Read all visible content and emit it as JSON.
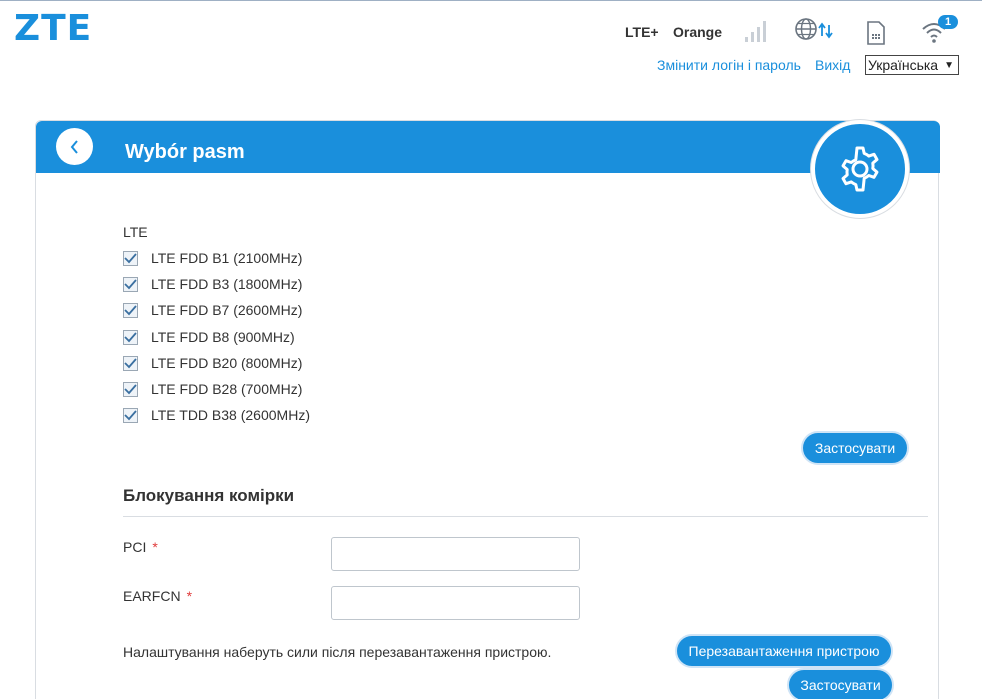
{
  "header": {
    "logo": "ZTE",
    "network_type": "LTE+",
    "operator": "Orange",
    "wifi_clients": "1",
    "change_login_link": "Змінити логін і пароль",
    "logout_link": "Вихід",
    "language": "Українська"
  },
  "icons": [
    "signal-icon",
    "globe-data-icon",
    "sim-icon",
    "wifi-icon",
    "back-arrow-icon",
    "gear-icon",
    "checkmark-icon"
  ],
  "colors": {
    "accent": "#1a8fdc",
    "required": "#e03a3a"
  },
  "panel": {
    "title": "Wybór pasm",
    "lte_section_label": "LTE",
    "bands": [
      {
        "label": "LTE FDD B1 (2100MHz)",
        "checked": true
      },
      {
        "label": "LTE FDD B3 (1800MHz)",
        "checked": true
      },
      {
        "label": "LTE FDD B7 (2600MHz)",
        "checked": true
      },
      {
        "label": "LTE FDD B8 (900MHz)",
        "checked": true
      },
      {
        "label": "LTE FDD B20 (800MHz)",
        "checked": true
      },
      {
        "label": "LTE FDD B28 (700MHz)",
        "checked": true
      },
      {
        "label": "LTE TDD B38 (2600MHz)",
        "checked": true
      }
    ],
    "apply_bands_label": "Застосувати"
  },
  "cell_lock": {
    "title": "Блокування комірки",
    "pci_label": "PCI",
    "earfcn_label": "EARFCN",
    "required_mark": "*",
    "pci_value": "",
    "earfcn_value": "",
    "note": "Налаштування наберуть сили після перезавантаження пристрою.",
    "reboot_label": "Перезавантаження пристрою",
    "apply_label": "Застосувати"
  }
}
